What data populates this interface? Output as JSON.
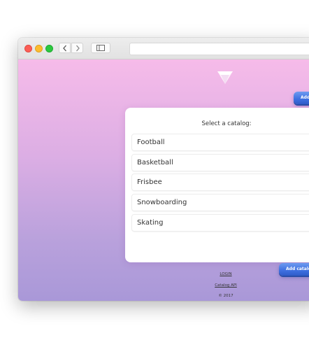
{
  "browser": {
    "back_icon": "chevron-left-icon",
    "forward_icon": "chevron-right-icon",
    "sidebar_icon": "sidebar-icon"
  },
  "header": {
    "logo_icon": "diamond-logo-icon",
    "add_button_label": "Add"
  },
  "card": {
    "title": "Select a catalog:",
    "items": [
      {
        "label": "Football"
      },
      {
        "label": "Basketball"
      },
      {
        "label": "Frisbee"
      },
      {
        "label": "Snowboarding"
      },
      {
        "label": "Skating"
      }
    ],
    "add_button_label": "Add catalog"
  },
  "footer": {
    "login_label": "LOGIN",
    "api_label": "Catalog API",
    "copyright": "© 2017"
  },
  "colors": {
    "gradient_top": "#f6bbe9",
    "gradient_bottom": "#a998d8",
    "button_blue": "#3e6fe0"
  }
}
